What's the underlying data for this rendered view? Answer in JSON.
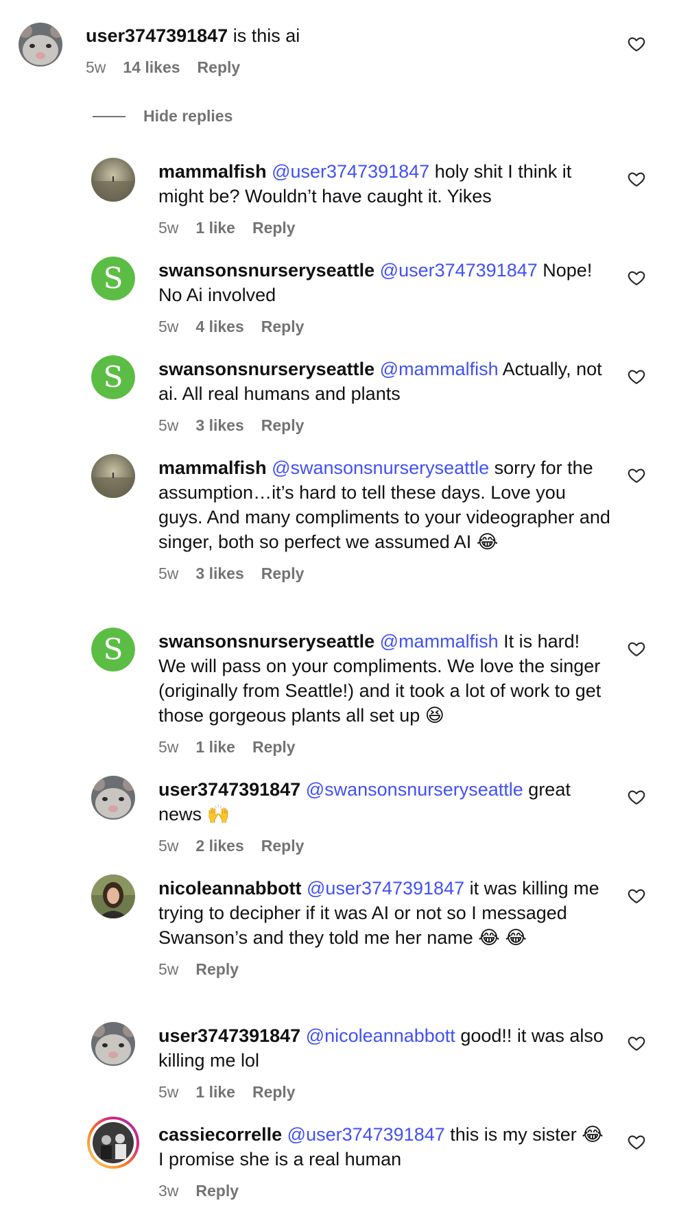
{
  "top_comment": {
    "username": "user3747391847",
    "text": "is this ai",
    "age": "5w",
    "likes": "14 likes",
    "reply_label": "Reply",
    "avatar": "rat-avatar"
  },
  "hide_replies_label": "Hide replies",
  "replies": [
    {
      "username": "mammalfish",
      "mention": "@user3747391847",
      "text": "holy shit I think it might be? Wouldn’t have caught it. Yikes",
      "age": "5w",
      "likes": "1 like",
      "reply_label": "Reply",
      "avatar": "fog-avatar"
    },
    {
      "username": "swansonsnurseryseattle",
      "mention": "@user3747391847",
      "text": "Nope! No Ai involved",
      "age": "5w",
      "likes": "4 likes",
      "reply_label": "Reply",
      "avatar": "swansons-avatar"
    },
    {
      "username": "swansonsnurseryseattle",
      "mention": "@mammalfish",
      "text": "Actually, not ai. All real humans and plants",
      "age": "5w",
      "likes": "3 likes",
      "reply_label": "Reply",
      "avatar": "swansons-avatar"
    },
    {
      "username": "mammalfish",
      "mention": "@swansonsnurseryseattle",
      "text": "sorry for the assumption…it’s hard to tell these days. Love you guys. And many compliments to your videographer and singer, both so perfect we assumed AI 😂",
      "age": "5w",
      "likes": "3 likes",
      "reply_label": "Reply",
      "avatar": "fog-avatar"
    },
    {
      "username": "swansonsnurseryseattle",
      "mention": "@mammalfish",
      "text": "It is hard! We will pass on your compliments. We love the singer (originally from Seattle!) and it took a lot of work to get those gorgeous plants all set up 😆",
      "age": "5w",
      "likes": "1 like",
      "reply_label": "Reply",
      "avatar": "swansons-avatar"
    },
    {
      "username": "user3747391847",
      "mention": "@swansonsnurseryseattle",
      "text": "great news 🙌",
      "age": "5w",
      "likes": "2 likes",
      "reply_label": "Reply",
      "avatar": "rat-avatar"
    },
    {
      "username": "nicoleannabbott",
      "mention": "@user3747391847",
      "text": "it was killing me trying to decipher if it was AI or not so I messaged Swanson’s and they told me her name 😂 😂",
      "age": "5w",
      "likes": "",
      "reply_label": "Reply",
      "avatar": "woman-avatar"
    },
    {
      "username": "user3747391847",
      "mention": "@nicoleannabbott",
      "text": "good!! it was also killing me lol",
      "age": "5w",
      "likes": "1 like",
      "reply_label": "Reply",
      "avatar": "rat-avatar"
    },
    {
      "username": "cassiecorrelle",
      "mention": "@user3747391847",
      "text": "this is my sister 😂 I promise she is a real human",
      "age": "3w",
      "likes": "",
      "reply_label": "Reply",
      "avatar": "story-ring-avatar"
    }
  ],
  "colors": {
    "mention": "#4150f7",
    "meta": "#737373",
    "swansons_green": "#5cbd45"
  },
  "icons": {
    "like": "heart-outline-icon"
  }
}
